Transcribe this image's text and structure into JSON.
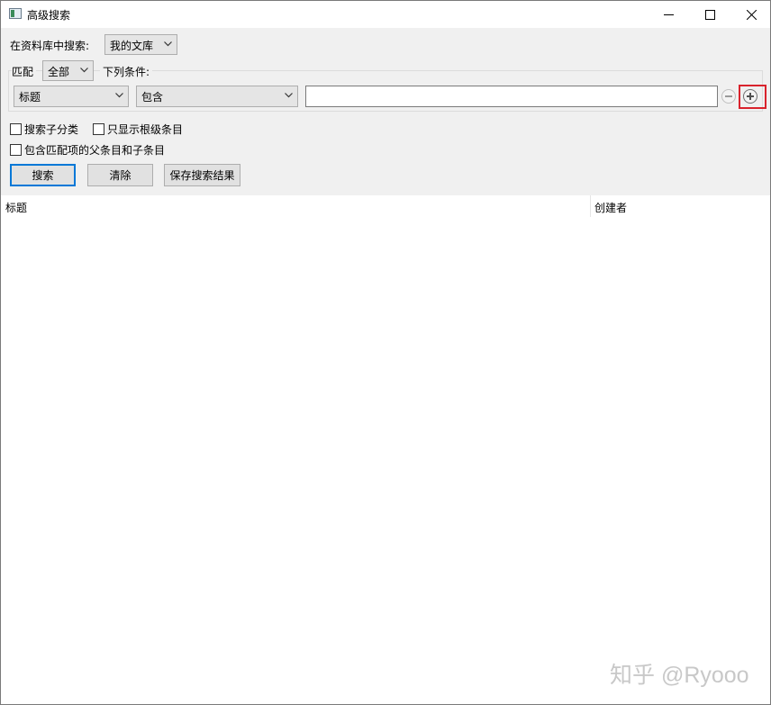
{
  "window": {
    "title": "高级搜索"
  },
  "search_scope": {
    "label": "在资料库中搜索:",
    "value": "我的文库"
  },
  "match": {
    "label": "匹配",
    "value": "全部",
    "suffix": "下列条件:"
  },
  "condition": {
    "field": "标题",
    "operator": "包含",
    "value": ""
  },
  "options": {
    "search_subcollections": "搜索子分类",
    "show_top_level_only": "只显示根级条目",
    "include_parents_children": "包含匹配项的父条目和子条目"
  },
  "buttons": {
    "search": "搜索",
    "clear": "清除",
    "save": "保存搜索结果"
  },
  "results_table": {
    "columns": [
      "标题",
      "创建者"
    ],
    "rows": []
  },
  "watermark": "知乎 @Ryooo",
  "icons": [
    "app-icon",
    "minimize-icon",
    "maximize-icon",
    "close-icon",
    "chevron-down-icon",
    "remove-condition-icon",
    "add-condition-icon"
  ],
  "colors": {
    "panel_bg": "#f0f0f0",
    "default_button_border": "#0078d7",
    "highlight": "#d9232d"
  }
}
